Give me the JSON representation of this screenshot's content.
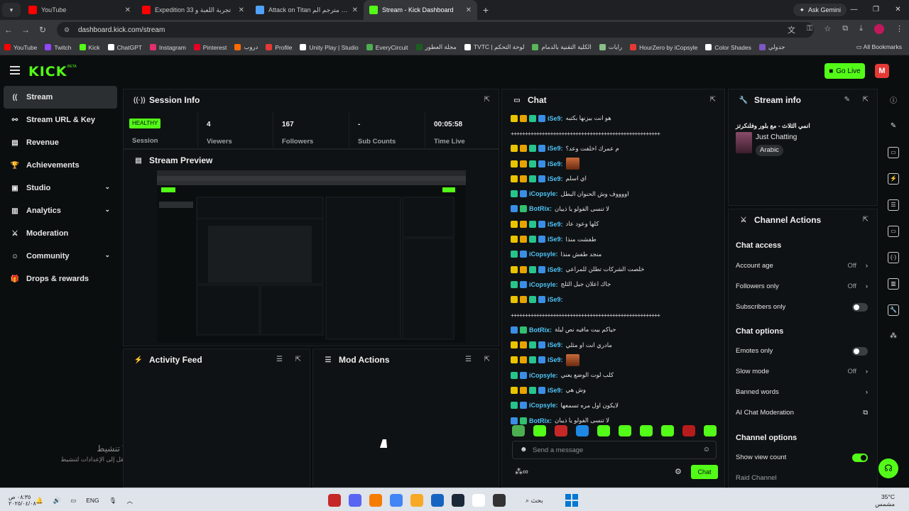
{
  "browser": {
    "tabs": [
      {
        "title": "YouTube",
        "color": "#ff0000"
      },
      {
        "title": "Expedition 33 تجربة اللعبة و",
        "color": "#ff0000"
      },
      {
        "title": "Attack on Titan انمي مترجم الم",
        "color": "#4fa3ff"
      },
      {
        "title": "Stream - Kick Dashboard",
        "color": "#53fc18"
      }
    ],
    "ask_gemini": "Ask Gemini",
    "url": "dashboard.kick.com/stream",
    "bookmarks": [
      {
        "label": "YouTube",
        "color": "#ff0000"
      },
      {
        "label": "Twitch",
        "color": "#9146ff"
      },
      {
        "label": "Kick",
        "color": "#53fc18"
      },
      {
        "label": "ChatGPT",
        "color": "#ffffff"
      },
      {
        "label": "Instagram",
        "color": "#e1306c"
      },
      {
        "label": "Pinterest",
        "color": "#e60023"
      },
      {
        "label": "دروب",
        "color": "#ff6b00"
      },
      {
        "label": "Profile",
        "color": "#e53935"
      },
      {
        "label": "Unity Play | Studio",
        "color": "#ffffff"
      },
      {
        "label": "EveryCircuit",
        "color": "#4caf50"
      },
      {
        "label": "مجلة العطور",
        "color": "#1b5e20"
      },
      {
        "label": "TVTC | لوحة التحكم",
        "color": "#ffffff"
      },
      {
        "label": "الكلية التقنية بالدمام",
        "color": "#5ab65a"
      },
      {
        "label": "رايات",
        "color": "#88c088"
      },
      {
        "label": "HourZero by iCopsyle",
        "color": "#e53935"
      },
      {
        "label": "Color Shades",
        "color": "#ffffff"
      },
      {
        "label": "جدولي",
        "color": "#7e57c2"
      }
    ],
    "all_bookmarks": "All Bookmarks"
  },
  "kick": {
    "logo": "KICK",
    "beta": "BETA",
    "go_live": "Go Live",
    "user_initial": "M",
    "accent": "#53fc18",
    "sidebar": [
      {
        "label": "Stream",
        "icon": "broadcast-icon",
        "glyph": "((·))",
        "active": true
      },
      {
        "label": "Stream URL & Key",
        "icon": "link-icon",
        "glyph": "⚯"
      },
      {
        "label": "Revenue",
        "icon": "revenue-icon",
        "glyph": "▤"
      },
      {
        "label": "Achievements",
        "icon": "trophy-icon",
        "glyph": "🏆"
      },
      {
        "label": "Studio",
        "icon": "studio-icon",
        "glyph": "▣",
        "chevron": true
      },
      {
        "label": "Analytics",
        "icon": "analytics-icon",
        "glyph": "▥",
        "chevron": true
      },
      {
        "label": "Moderation",
        "icon": "sword-icon",
        "glyph": "⚔"
      },
      {
        "label": "Community",
        "icon": "community-icon",
        "glyph": "☺",
        "chevron": true
      },
      {
        "label": "Drops & rewards",
        "icon": "gift-icon",
        "glyph": "🎁"
      }
    ],
    "windows_activation": {
      "title": "تنشيط Windows",
      "subtitle": "انتقل إلى الإعدادات لتنشيط Windows."
    },
    "session": {
      "title": "Session Info",
      "status": "HEALTHY",
      "status_label": "Session",
      "stats": [
        {
          "value": "4",
          "label": "Viewers"
        },
        {
          "value": "167",
          "label": "Followers"
        },
        {
          "value": "-",
          "label": "Sub Counts"
        },
        {
          "value": "00:05:58",
          "label": "Time Live"
        }
      ]
    },
    "preview": {
      "title": "Stream Preview"
    },
    "activity": {
      "title": "Activity Feed"
    },
    "mod_actions": {
      "title": "Mod Actions"
    },
    "chat": {
      "title": "Chat",
      "messages": [
        {
          "user": "iSe9:",
          "color": "#4fc3f7",
          "badges": [
            "y",
            "o",
            "g",
            "b"
          ],
          "text": "هو انت بيزنها بكتبه"
        },
        {
          "user": "",
          "color": "#4fc3f7",
          "badges": [],
          "text": "+++++++++++++++++++++++++++++++++++++++++++++++++++++",
          "long": true
        },
        {
          "user": "iSe9:",
          "color": "#4fc3f7",
          "badges": [
            "y",
            "o",
            "g",
            "b"
          ],
          "text": "م عمرك اخلفت وعد؟"
        },
        {
          "user": "iSe9:",
          "color": "#4fc3f7",
          "badges": [
            "y",
            "o",
            "g",
            "b"
          ],
          "text": "",
          "emote": true
        },
        {
          "user": "iSe9:",
          "color": "#4fc3f7",
          "badges": [
            "y",
            "o",
            "g",
            "b"
          ],
          "text": "اي اسلم"
        },
        {
          "user": "iCopsyle:",
          "color": "#4fc3f7",
          "badges": [
            "g",
            "b"
          ],
          "text": "اووووف وش الحنوان البطل"
        },
        {
          "user": "BotRix:",
          "color": "#4fc3f7",
          "badges": [
            "b",
            "k"
          ],
          "text": "لا تنسى الفولو يا ذيبان"
        },
        {
          "user": "iSe9:",
          "color": "#4fc3f7",
          "badges": [
            "y",
            "o",
            "g",
            "b"
          ],
          "text": "كلها وعود عاد"
        },
        {
          "user": "iSe9:",
          "color": "#4fc3f7",
          "badges": [
            "y",
            "o",
            "g",
            "b"
          ],
          "text": "طفشت منذا"
        },
        {
          "user": "iCopsyle:",
          "color": "#4fc3f7",
          "badges": [
            "g",
            "b"
          ],
          "text": "منجد طفش منذا"
        },
        {
          "user": "iSe9:",
          "color": "#4fc3f7",
          "badges": [
            "y",
            "o",
            "g",
            "b"
          ],
          "text": "خلصت الشركات تطلن للمراعي"
        },
        {
          "user": "iCopsyle:",
          "color": "#4fc3f7",
          "badges": [
            "g",
            "b"
          ],
          "text": "جاك اعلان جبل الثلج"
        },
        {
          "user": "iSe9:",
          "color": "#4fc3f7",
          "badges": [
            "y",
            "o",
            "g",
            "b"
          ],
          "text": ""
        },
        {
          "user": "",
          "color": "#4fc3f7",
          "badges": [],
          "text": "+++++++++++++++++++++++++++++++++++++++++++++++++++++",
          "long": true
        },
        {
          "user": "BotRix:",
          "color": "#4fc3f7",
          "badges": [
            "b",
            "k"
          ],
          "text": "حياكم بيت مافيه نص ليلة"
        },
        {
          "user": "iSe9:",
          "color": "#4fc3f7",
          "badges": [
            "y",
            "o",
            "g",
            "b"
          ],
          "text": "مادري انت او مثلي"
        },
        {
          "user": "iSe9:",
          "color": "#4fc3f7",
          "badges": [
            "y",
            "o",
            "g",
            "b"
          ],
          "text": "",
          "emote": true
        },
        {
          "user": "iCopsyle:",
          "color": "#4fc3f7",
          "badges": [
            "g",
            "b"
          ],
          "text": "كلب لوت الوضع يعني"
        },
        {
          "user": "iSe9:",
          "color": "#4fc3f7",
          "badges": [
            "y",
            "o",
            "g",
            "b"
          ],
          "text": "وش هي"
        },
        {
          "user": "iCopsyle:",
          "color": "#4fc3f7",
          "badges": [
            "g",
            "b"
          ],
          "text": "لايكون اول مره تسمعها"
        },
        {
          "user": "BotRix:",
          "color": "#4fc3f7",
          "badges": [
            "b",
            "k"
          ],
          "text": "لا تنسى الفولو يا ذيبان"
        }
      ],
      "emote_colors": [
        "#4caf50",
        "#53fc18",
        "#c62828",
        "#1e88e5",
        "#53fc18",
        "#53fc18",
        "#53fc18",
        "#53fc18",
        "#b71c1c",
        "#53fc18"
      ],
      "placeholder": "Send a message",
      "send": "Chat"
    },
    "stream_info": {
      "title": "Stream info",
      "stream_title": "انمي الثلاث - مع بلور وفلنكرتز",
      "category": "Just Chatting",
      "tag": "Arabic"
    },
    "channel_actions": {
      "title": "Channel Actions",
      "chat_access": "Chat access",
      "account_age": {
        "label": "Account age",
        "value": "Off"
      },
      "followers_only": {
        "label": "Followers only",
        "value": "Off"
      },
      "subscribers_only": {
        "label": "Subscribers only",
        "on": false
      },
      "chat_options": "Chat options",
      "emotes_only": {
        "label": "Emotes only",
        "on": false
      },
      "slow_mode": {
        "label": "Slow mode",
        "value": "Off"
      },
      "banned_words": {
        "label": "Banned words"
      },
      "ai_moderation": {
        "label": "AI Chat Moderation"
      },
      "channel_options": "Channel options",
      "show_view_count": {
        "label": "Show view count",
        "on": true
      },
      "raid_channel": {
        "label": "Raid Channel"
      }
    }
  },
  "taskbar": {
    "time": "٠٨:٣٥ ص",
    "date": "٢٠٢٥/٠٤/٠٨",
    "lang": "ENG",
    "search": "بحث",
    "weather_temp": "35°C",
    "weather_desc": "مشمس"
  }
}
